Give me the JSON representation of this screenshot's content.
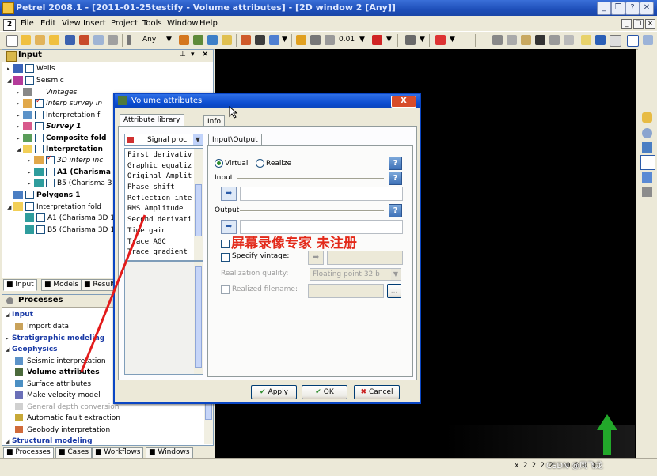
{
  "app": {
    "title": "Petrel 2008.1 - [2011-01-25testify - Volume attributes] - [2D window 2 [Any]]",
    "menu": [
      "File",
      "Edit",
      "View",
      "Insert",
      "Project",
      "Tools",
      "Window",
      "Help"
    ],
    "mdi_icon_label": "2"
  },
  "toolbar": {
    "domain_label": "Any",
    "value_label": "0.01"
  },
  "input_pane": {
    "title": "Input",
    "tree": [
      {
        "label": "Wells",
        "checked": false,
        "style": "normal"
      },
      {
        "label": "Seismic",
        "checked": false,
        "style": "normal"
      },
      {
        "label": "Vintages",
        "checked": false,
        "style": "italic"
      },
      {
        "label": "Interp survey in",
        "checked": true,
        "style": "italic"
      },
      {
        "label": "Interpretation f",
        "checked": false,
        "style": "normal"
      },
      {
        "label": "Survey 1",
        "checked": false,
        "style": "bolditalic"
      },
      {
        "label": "Composite fold",
        "checked": false,
        "style": "bold"
      },
      {
        "label": "Interpretation",
        "checked": false,
        "style": "bold"
      },
      {
        "label": "3D interp inc",
        "checked": true,
        "style": "italic"
      },
      {
        "label": "A1 (Charisma",
        "checked": false,
        "style": "bold"
      },
      {
        "label": "B5 (Charisma 3",
        "checked": false,
        "style": "normal"
      },
      {
        "label": "Polygons 1",
        "checked": false,
        "style": "bold"
      },
      {
        "label": "Interpretation fold",
        "checked": false,
        "style": "normal"
      },
      {
        "label": "A1 (Charisma 3D 1",
        "checked": false,
        "style": "normal"
      },
      {
        "label": "B5 (Charisma 3D 1",
        "checked": false,
        "style": "normal"
      }
    ],
    "tabs": [
      "Input",
      "Models",
      "Result"
    ]
  },
  "proc_pane": {
    "title": "Processes",
    "items": [
      {
        "label": "Input",
        "kind": "cat"
      },
      {
        "label": "Import data",
        "kind": "item"
      },
      {
        "label": "Stratigraphic modeling",
        "kind": "cat"
      },
      {
        "label": "Geophysics",
        "kind": "cat"
      },
      {
        "label": "Seismic interpretation",
        "kind": "item"
      },
      {
        "label": "Volume attributes",
        "kind": "bold"
      },
      {
        "label": "Surface attributes",
        "kind": "item"
      },
      {
        "label": "Make velocity model",
        "kind": "item"
      },
      {
        "label": "General depth conversion",
        "kind": "dis"
      },
      {
        "label": "Automatic fault extraction",
        "kind": "item"
      },
      {
        "label": "Geobody interpretation",
        "kind": "item"
      },
      {
        "label": "Structural modeling",
        "kind": "cat"
      }
    ],
    "tabs": [
      "Processes",
      "Cases",
      "Workflows",
      "Windows"
    ]
  },
  "dialog": {
    "title": "Volume attributes",
    "close_label": "X",
    "tabs": [
      "Attribute library",
      "Info"
    ],
    "combo": "Signal proc",
    "attributes": [
      "First derivativ",
      "Graphic equaliz",
      "Original Amplit",
      "Phase shift",
      "Reflection inte",
      "RMS Amplitude",
      "Second derivati",
      "Time gain",
      "Trace AGC",
      "Trace gradient"
    ],
    "inner_tab": "Input\\Output",
    "radio_virtual": "Virtual",
    "radio_realize": "Realize",
    "input_label": "Input",
    "output_label": "Output",
    "specify_vintage": "Specify vintage:",
    "realization_quality": "Realization quality:",
    "quality_value": "Floating point 32 b",
    "realized_filename": "Realized filename:",
    "browse_label": "...",
    "help_icon": "?",
    "buttons": {
      "apply": "Apply",
      "ok": "OK",
      "cancel": "Cancel"
    }
  },
  "watermark": "屏幕录像专家 未注册",
  "statusbar": {
    "coords": "x 2 2 2 2 . 0 0 0 0",
    "credit": "CSDN @风飞龙"
  },
  "colors": {
    "titlebar": "#1e4fb9",
    "dialog_border": "#0a46c4",
    "watermark": "#e32a1a",
    "arrow_green": "#22a82a",
    "viewport": "#000000"
  }
}
